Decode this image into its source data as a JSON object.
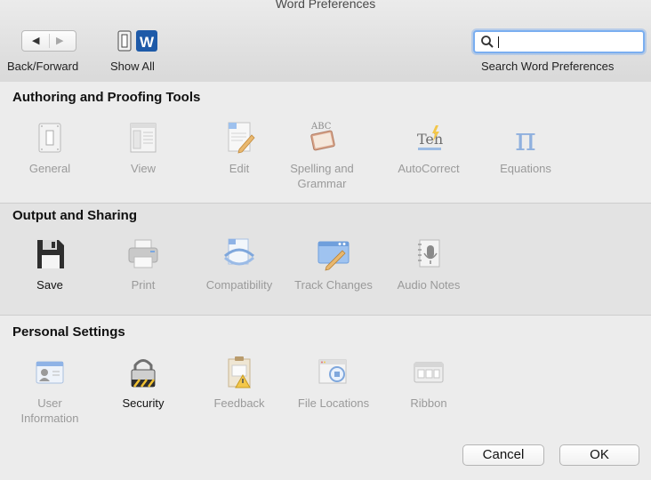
{
  "window": {
    "title": "Word Preferences"
  },
  "toolbar": {
    "back_forward_label": "Back/Forward",
    "back_glyph": "◀",
    "forward_glyph": "▶",
    "show_all_label": "Show All",
    "search_caption": "Search Word Preferences",
    "search_value": ""
  },
  "sections": [
    {
      "title": "Authoring and Proofing Tools",
      "items": [
        {
          "label": "General",
          "icon": "general-icon"
        },
        {
          "label": "View",
          "icon": "view-icon"
        },
        {
          "label": "Edit",
          "icon": "edit-icon"
        },
        {
          "label": "Spelling and Grammar",
          "line1": "Spelling and",
          "line2": "Grammar",
          "icon": "spelling-icon"
        },
        {
          "label": "AutoCorrect",
          "icon": "autocorrect-icon",
          "glyph": "Teh"
        },
        {
          "label": "Equations",
          "icon": "pi-icon",
          "glyph": "π"
        }
      ]
    },
    {
      "title": "Output and Sharing",
      "items": [
        {
          "label": "Save",
          "icon": "floppy-disk-icon"
        },
        {
          "label": "Print",
          "icon": "printer-icon"
        },
        {
          "label": "Compatibility",
          "icon": "compatibility-icon"
        },
        {
          "label": "Track Changes",
          "icon": "track-changes-icon"
        },
        {
          "label": "Audio Notes",
          "icon": "microphone-icon"
        }
      ]
    },
    {
      "title": "Personal Settings",
      "items": [
        {
          "label": "User Information",
          "line1": "User",
          "line2": "Information",
          "icon": "user-card-icon"
        },
        {
          "label": "Security",
          "icon": "padlock-icon"
        },
        {
          "label": "Feedback",
          "icon": "feedback-icon"
        },
        {
          "label": "File Locations",
          "icon": "file-locations-icon"
        },
        {
          "label": "Ribbon",
          "icon": "ribbon-icon"
        }
      ]
    }
  ],
  "buttons": {
    "cancel": "Cancel",
    "ok": "OK"
  }
}
